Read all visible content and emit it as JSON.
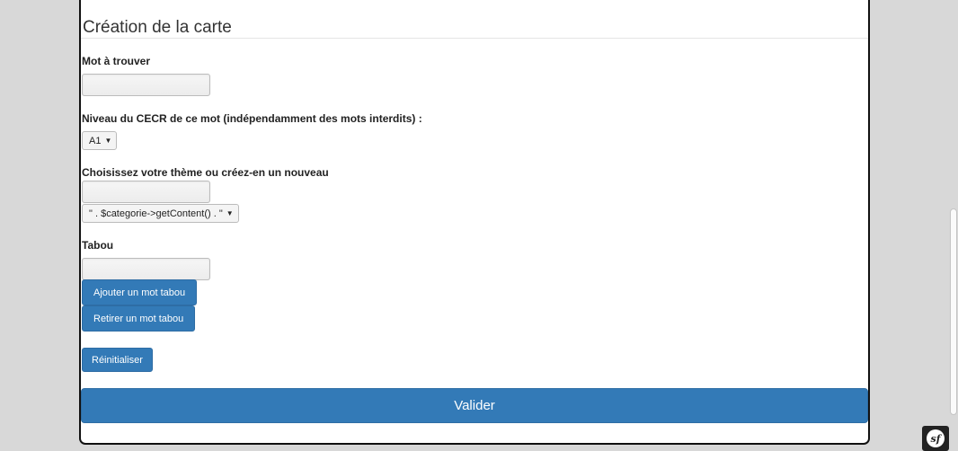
{
  "form": {
    "title": "Création de la carte",
    "word_label": "Mot à trouver",
    "word_value": "",
    "level_label": "Niveau du CECR de ce mot (indépendamment des mots interdits) :",
    "level_selected": "A1",
    "theme_label": "Choisissez votre thème ou créez-en un nouveau",
    "theme_value": "",
    "theme_selected": "\" . $categorie->getContent() . \"",
    "taboo_label": "Tabou",
    "taboo_value": "",
    "add_taboo_label": "Ajouter un mot tabou",
    "remove_taboo_label": "Retirer un mot tabou",
    "reset_label": "Réinitialiser",
    "submit_label": "Valider"
  },
  "icons": {
    "select_chevron": "chevron-down-icon",
    "debug_toolbar": "symfony-icon"
  },
  "colors": {
    "primary": "#337ab7",
    "page_background": "#d8d8d8"
  }
}
